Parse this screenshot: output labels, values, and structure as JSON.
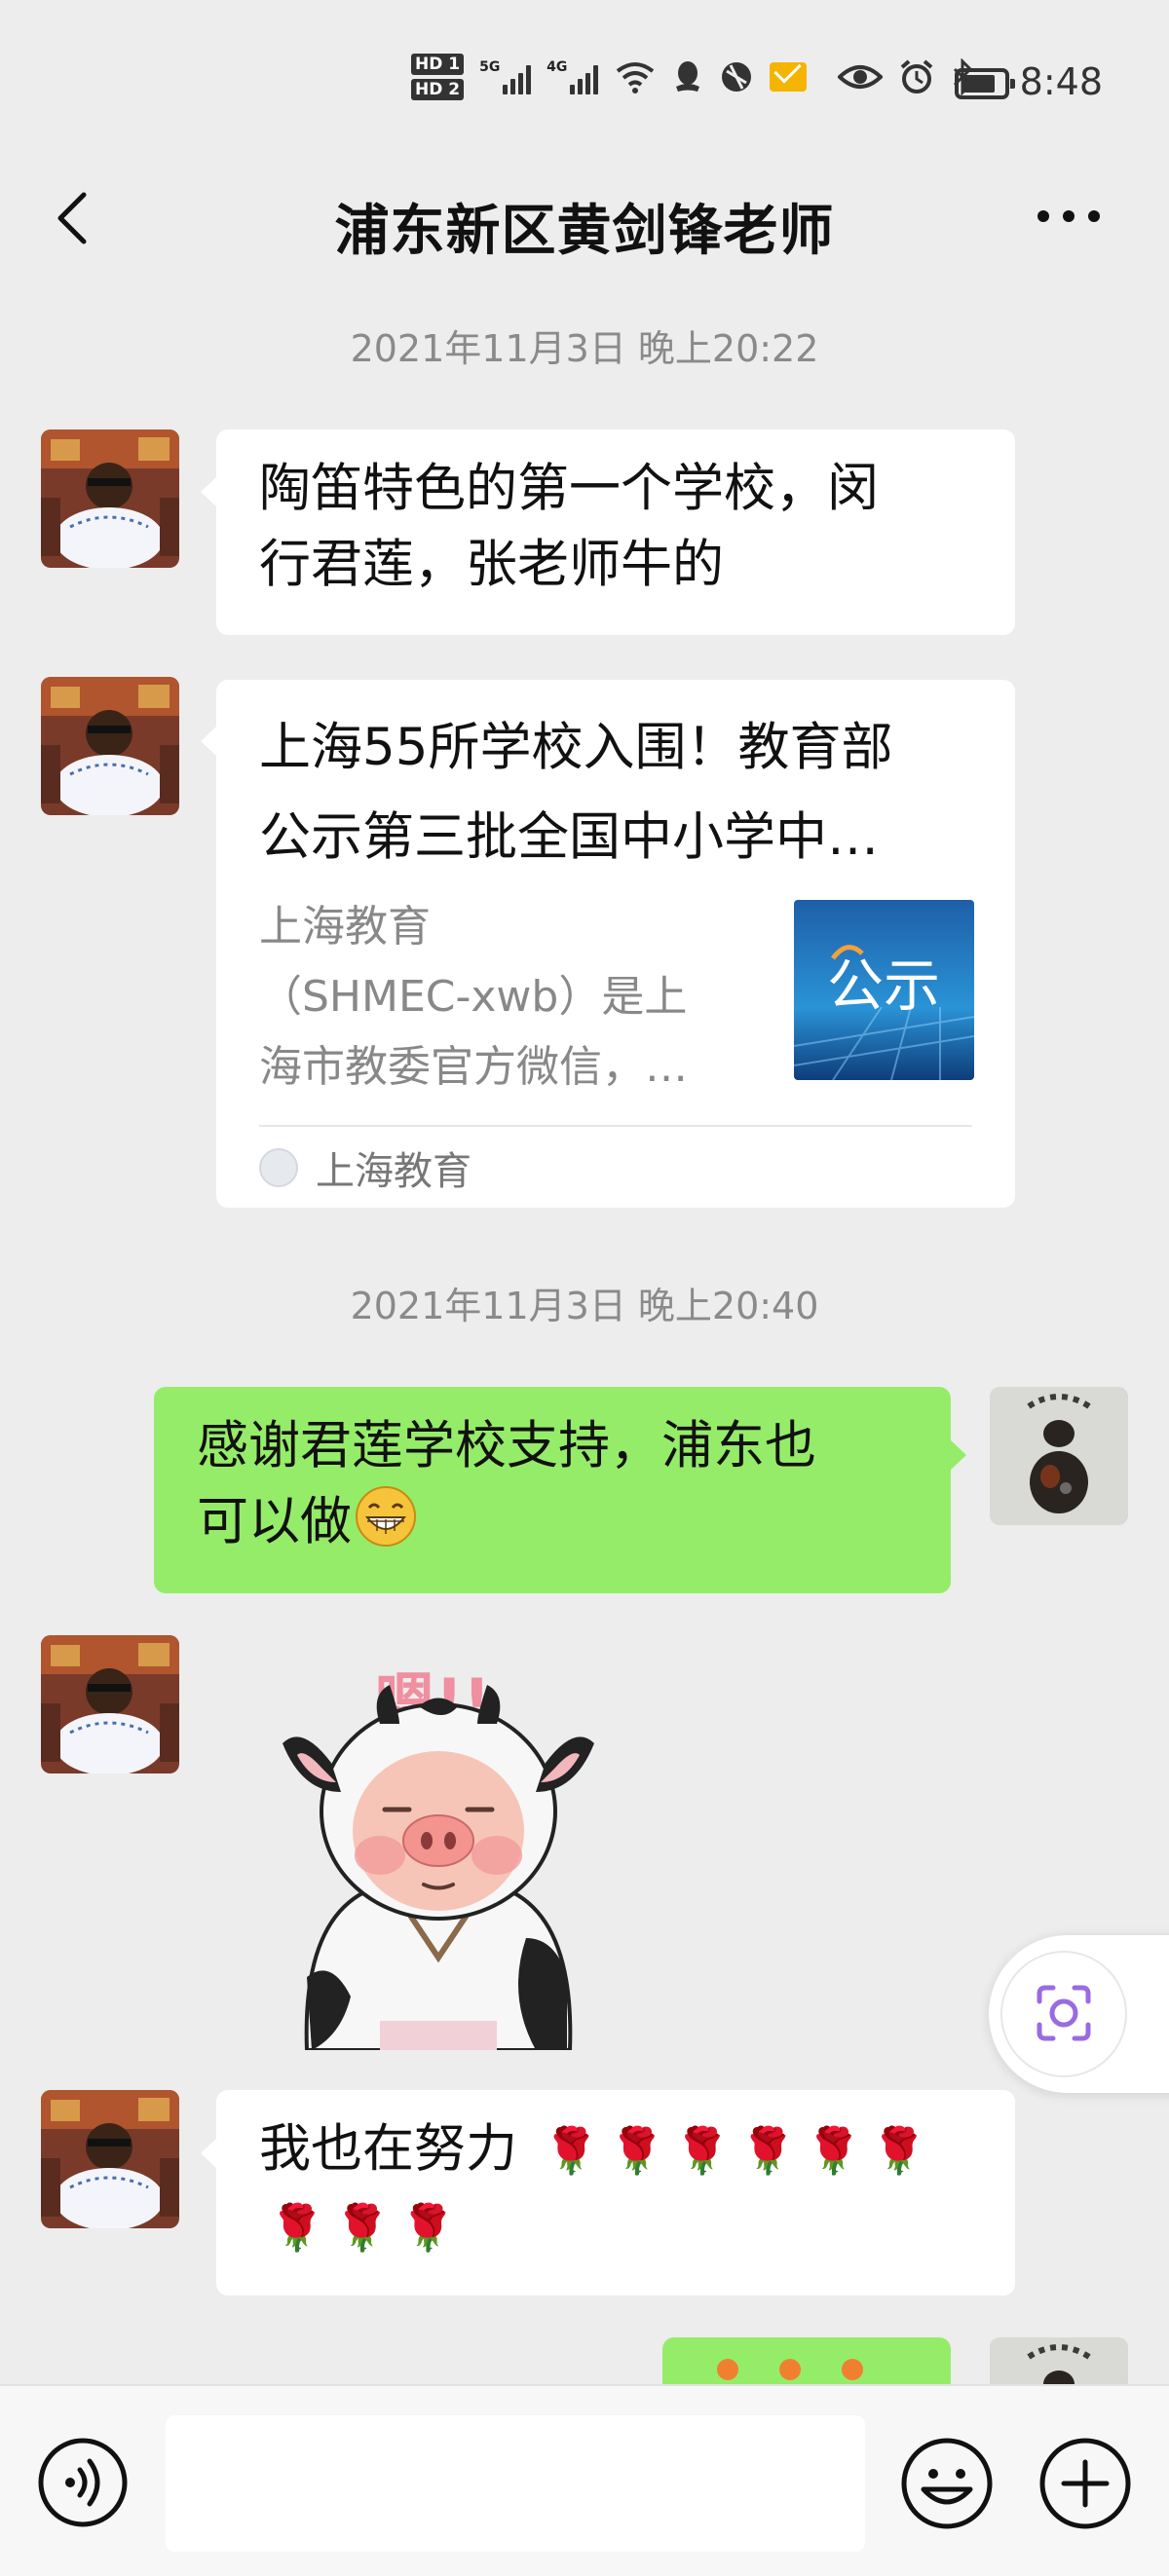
{
  "status_bar": {
    "hd1": "HD 1",
    "hd2": "HD 2",
    "net1": "5G",
    "net2": "4G",
    "time": "8:48",
    "icons": [
      "hd-icon",
      "signal-icon",
      "wifi-icon",
      "qq-icon",
      "browser-icon",
      "mail-icon",
      "eye-icon",
      "alarm-icon",
      "bluetooth-icon",
      "battery-icon"
    ]
  },
  "header": {
    "title": "浦东新区黄剑锋老师",
    "back_icon": "chevron-left-icon",
    "more_icon": "more-icon"
  },
  "messages": {
    "time1": "2021年11月3日 晚上20:22",
    "msg1_line1": "陶笛特色的第一个学校，闵",
    "msg1_line2": "行君莲，张老师牛的",
    "card": {
      "title_line1": "上海55所学校入围！教育部",
      "title_line2": "公示第三批全国中小学中…",
      "desc_line1": "上海教育",
      "desc_line2": "（SHMEC-xwb）是上",
      "desc_line3": "海市教委官方微信，…",
      "thumb_text": "公示",
      "source": "上海教育"
    },
    "time2": "2021年11月3日 晚上20:40",
    "msg_me_line1": "感谢君莲学校支持，浦东也",
    "msg_me_line2": "可以做",
    "sticker_text": "嗯!!",
    "msg3_text": "我也在努力",
    "rose_emoji": "🌹"
  },
  "bottom": {
    "voice_icon": "voice-icon",
    "emoji_icon": "emoji-icon",
    "plus_icon": "plus-icon"
  },
  "colors": {
    "background": "#ededed",
    "my_bubble": "#95ec69",
    "other_bubble": "#ffffff",
    "timestamp": "#8a8a8a"
  }
}
